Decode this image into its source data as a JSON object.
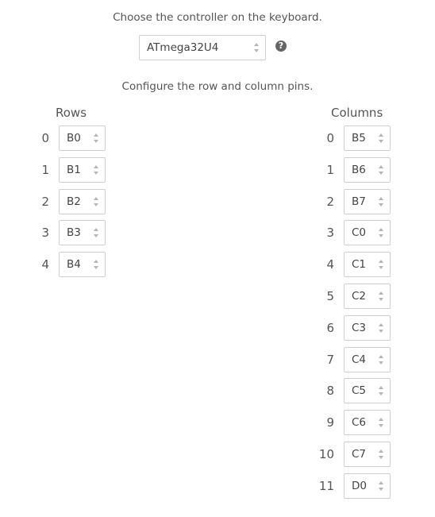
{
  "controller": {
    "instruction": "Choose the controller on the keyboard.",
    "selected": "ATmega32U4"
  },
  "pins": {
    "instruction": "Configure the row and column pins.",
    "rows_heading": "Rows",
    "columns_heading": "Columns",
    "rows": [
      {
        "index": "0",
        "pin": "B0"
      },
      {
        "index": "1",
        "pin": "B1"
      },
      {
        "index": "2",
        "pin": "B2"
      },
      {
        "index": "3",
        "pin": "B3"
      },
      {
        "index": "4",
        "pin": "B4"
      }
    ],
    "columns": [
      {
        "index": "0",
        "pin": "B5"
      },
      {
        "index": "1",
        "pin": "B6"
      },
      {
        "index": "2",
        "pin": "B7"
      },
      {
        "index": "3",
        "pin": "C0"
      },
      {
        "index": "4",
        "pin": "C1"
      },
      {
        "index": "5",
        "pin": "C2"
      },
      {
        "index": "6",
        "pin": "C3"
      },
      {
        "index": "7",
        "pin": "C4"
      },
      {
        "index": "8",
        "pin": "C5"
      },
      {
        "index": "9",
        "pin": "C6"
      },
      {
        "index": "10",
        "pin": "C7"
      },
      {
        "index": "11",
        "pin": "D0"
      }
    ]
  },
  "icons": {
    "help": "question-circle-icon",
    "select_arrows": "sort-arrows-icon"
  }
}
